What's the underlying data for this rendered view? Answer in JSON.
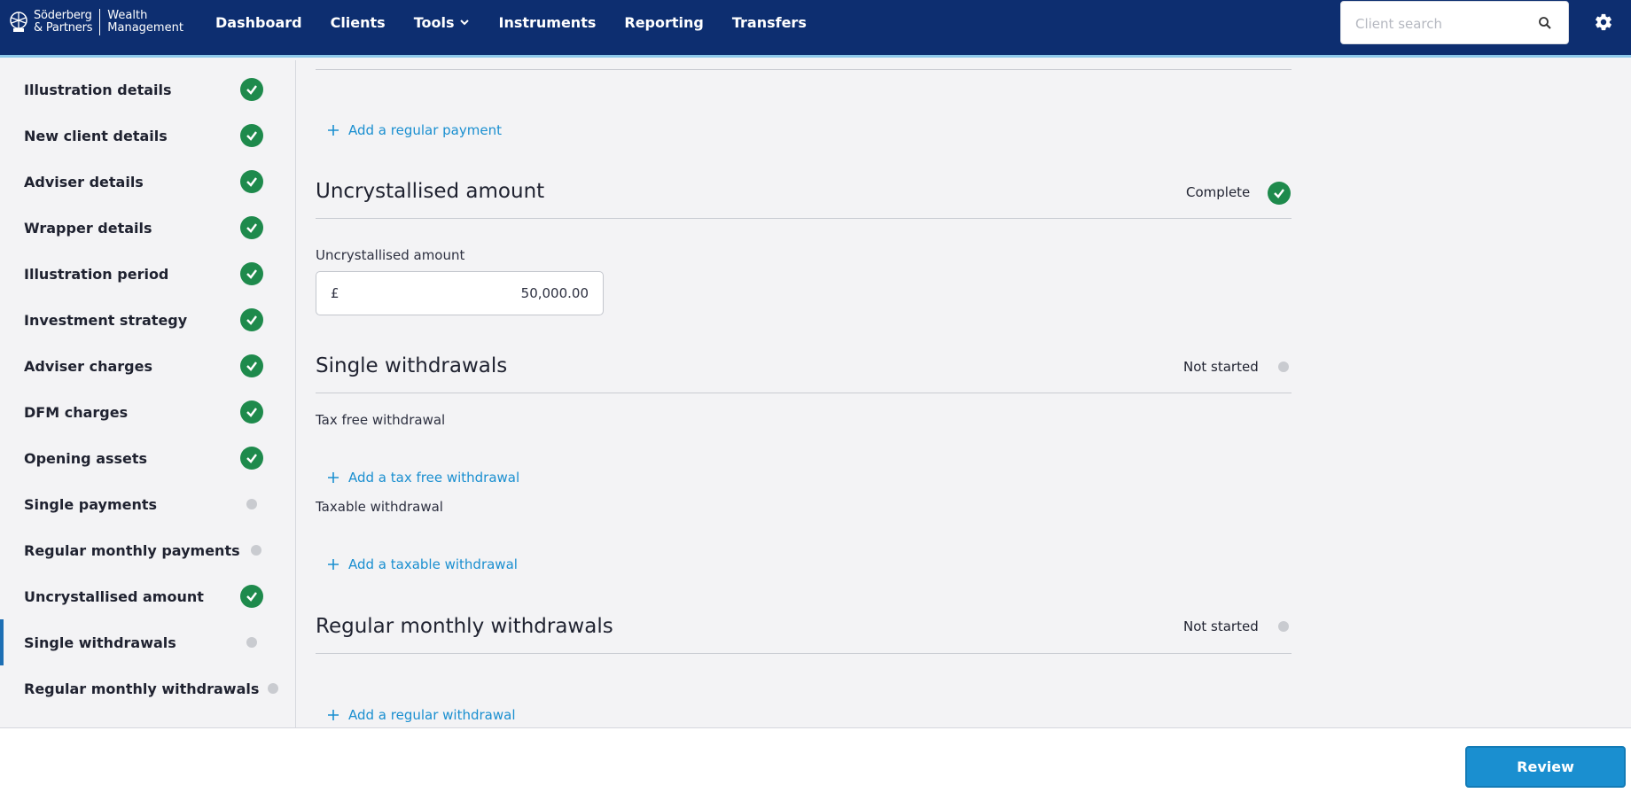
{
  "header": {
    "brand_line1": "Söderberg",
    "brand_line2": "& Partners",
    "brand_sub1": "Wealth",
    "brand_sub2": "Management",
    "nav": [
      "Dashboard",
      "Clients",
      "Tools",
      "Instruments",
      "Reporting",
      "Transfers"
    ],
    "search_placeholder": "Client search"
  },
  "sidebar": {
    "items": [
      {
        "label": "Illustration details",
        "status": "complete"
      },
      {
        "label": "New client details",
        "status": "complete"
      },
      {
        "label": "Adviser details",
        "status": "complete"
      },
      {
        "label": "Wrapper details",
        "status": "complete"
      },
      {
        "label": "Illustration period",
        "status": "complete"
      },
      {
        "label": "Investment strategy",
        "status": "complete"
      },
      {
        "label": "Adviser charges",
        "status": "complete"
      },
      {
        "label": "DFM charges",
        "status": "complete"
      },
      {
        "label": "Opening assets",
        "status": "complete"
      },
      {
        "label": "Single payments",
        "status": "not-started"
      },
      {
        "label": "Regular monthly payments",
        "status": "not-started"
      },
      {
        "label": "Uncrystallised amount",
        "status": "complete"
      },
      {
        "label": "Single withdrawals",
        "status": "not-started",
        "active": true
      },
      {
        "label": "Regular monthly withdrawals",
        "status": "not-started"
      }
    ]
  },
  "main": {
    "add_regular_payment": "Add a regular payment",
    "uncrystallised": {
      "title": "Uncrystallised amount",
      "status": "Complete",
      "field_label": "Uncrystallised amount",
      "currency": "£",
      "value": "50,000.00"
    },
    "single_withdrawals": {
      "title": "Single withdrawals",
      "status": "Not started",
      "tax_free_label": "Tax free withdrawal",
      "add_tax_free": "Add a tax free withdrawal",
      "taxable_label": "Taxable withdrawal",
      "add_taxable": "Add a taxable withdrawal"
    },
    "regular_withdrawals": {
      "title": "Regular monthly withdrawals",
      "status": "Not started",
      "add_regular": "Add a regular withdrawal"
    }
  },
  "footer": {
    "review_label": "Review"
  },
  "colors": {
    "header_bg": "#0d2e70",
    "accent": "#1a8fd0",
    "complete": "#1e8a4c",
    "not_started": "#c9cbd0"
  }
}
